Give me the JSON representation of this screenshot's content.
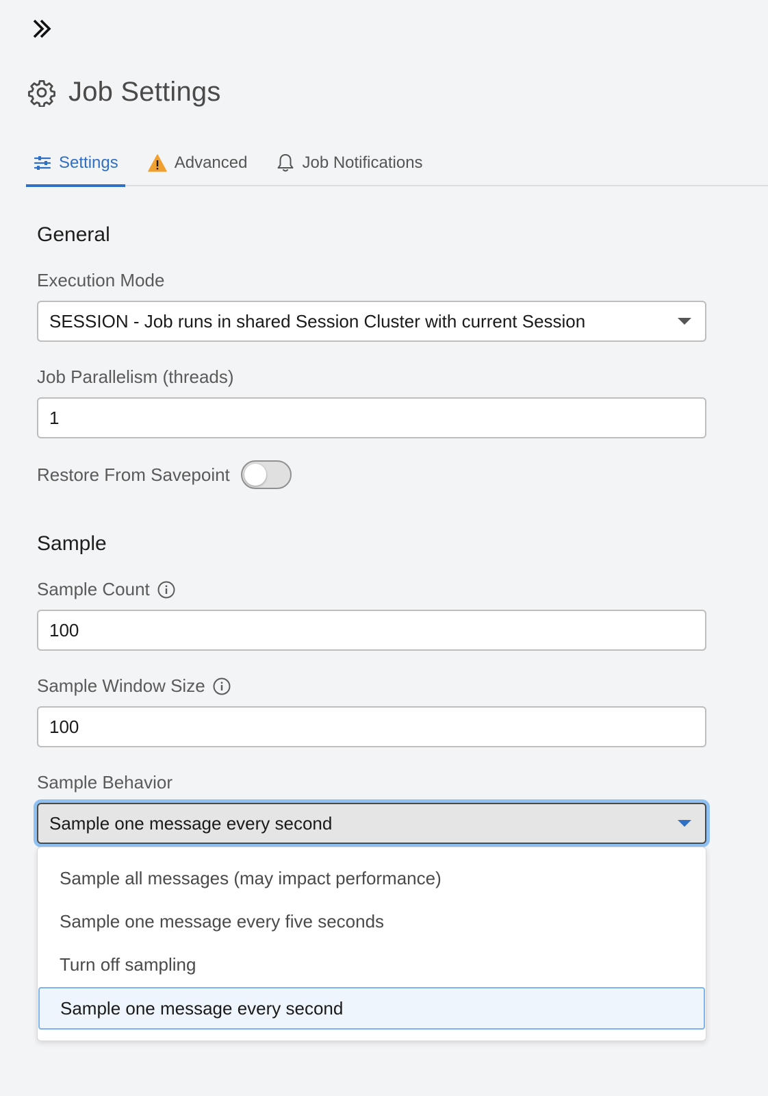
{
  "panel": {
    "expand_icon": "double-chevron-right-icon",
    "title": "Job Settings",
    "title_icon": "gear-icon"
  },
  "tabs": [
    {
      "label": "Settings",
      "icon": "sliders-icon",
      "active": true
    },
    {
      "label": "Advanced",
      "icon": "warning-icon",
      "active": false
    },
    {
      "label": "Job Notifications",
      "icon": "bell-icon",
      "active": false
    }
  ],
  "general": {
    "title": "General",
    "execution_mode": {
      "label": "Execution Mode",
      "value": "SESSION - Job runs in shared Session Cluster with current Session"
    },
    "parallelism": {
      "label": "Job Parallelism (threads)",
      "value": "1"
    },
    "restore_savepoint": {
      "label": "Restore From Savepoint",
      "enabled": false
    }
  },
  "sample": {
    "title": "Sample",
    "count": {
      "label": "Sample Count",
      "value": "100"
    },
    "window_size": {
      "label": "Sample Window Size",
      "value": "100"
    },
    "behavior": {
      "label": "Sample Behavior",
      "value": "Sample one message every second",
      "options": [
        "Sample all messages (may impact performance)",
        "Sample one message every five seconds",
        "Turn off sampling",
        "Sample one message every second"
      ],
      "selected_index": 3
    }
  },
  "colors": {
    "accent": "#2f6fc4",
    "warning": "#f0a030",
    "focus_ring": "#8ec1f2",
    "selected_option_bg": "#eef5fd"
  }
}
